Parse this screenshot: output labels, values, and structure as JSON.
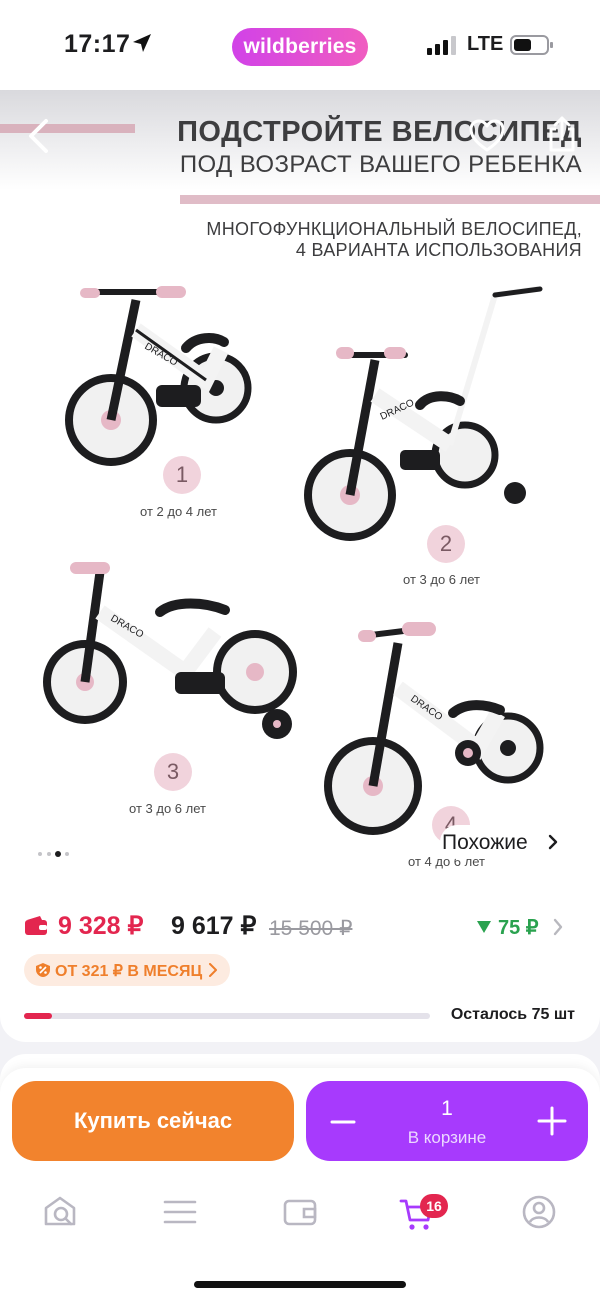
{
  "status_bar": {
    "time": "17:17",
    "app_name": "wildberries",
    "network": "LTE"
  },
  "product_gallery": {
    "promo_line1": "ПОДСТРОЙТЕ ВЕЛОСИПЕД",
    "promo_line2": "ПОД ВОЗРАСТ ВАШЕГО РЕБЕНКА",
    "promo_line3": "МНОГОФУНКЦИОНАЛЬНЫЙ ВЕЛОСИПЕД,",
    "promo_line4": "4 ВАРИАНТА ИСПОЛЬЗОВАНИЯ",
    "bike_brand": "DRACO",
    "variants": [
      {
        "number": "1",
        "age": "от 2 до 4 лет"
      },
      {
        "number": "2",
        "age": "от 3 до 6 лет"
      },
      {
        "number": "3",
        "age": "от 3 до 6 лет"
      },
      {
        "number": "4",
        "age": "от 4 до 6 лет"
      }
    ],
    "carousel": {
      "total": 4,
      "active": 2
    },
    "similar_label": "Похожие"
  },
  "price": {
    "wallet_price": "9 328 ₽",
    "regular_price": "9 617 ₽",
    "old_price": "15 500 ₽",
    "bonus": "75 ₽",
    "installment": "ОТ 321 ₽ В МЕСЯЦ",
    "stock_label": "Осталось 75 шт",
    "stock_fraction": 0.07
  },
  "actions": {
    "buy_now": "Купить сейчас",
    "cart_quantity": "1",
    "cart_status": "В корзине"
  },
  "tab_bar": {
    "cart_badge": "16",
    "active_tab": "cart"
  },
  "colors": {
    "brand_gradient_start": "#d142e8",
    "brand_gradient_end": "#f05cc0",
    "price_red": "#e3264f",
    "bonus_green": "#2aa24f",
    "buy_orange": "#f2832d",
    "cart_purple": "#a73afd"
  }
}
